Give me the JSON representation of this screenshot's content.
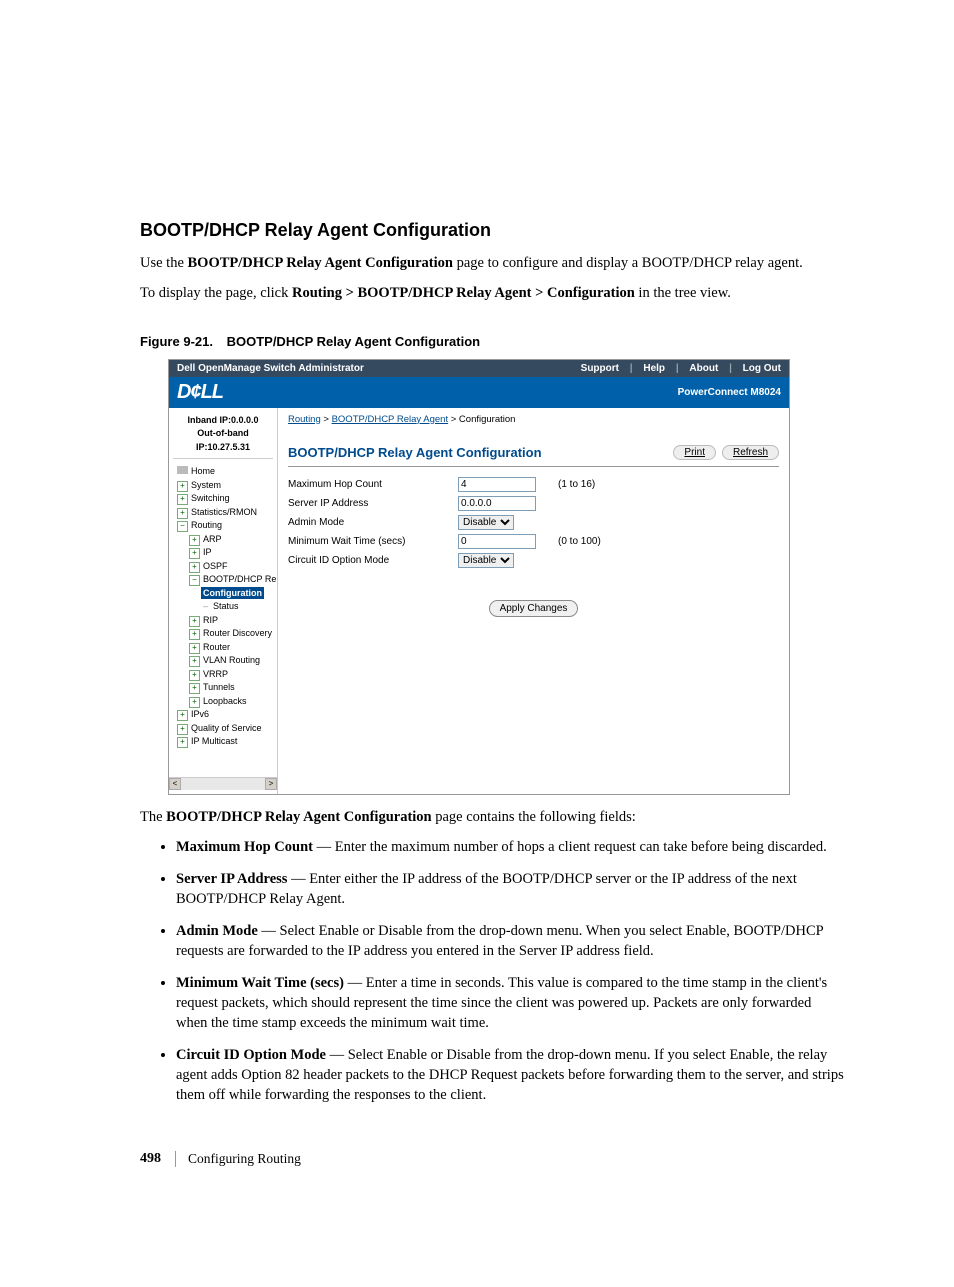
{
  "section_title": "BOOTP/DHCP Relay Agent Configuration",
  "intro1_pre": "Use the ",
  "intro1_bold": "BOOTP/DHCP Relay Agent Configuration",
  "intro1_post": " page to configure and display a BOOTP/DHCP relay agent.",
  "intro2_pre": "To display the page, click ",
  "intro2_bold": "Routing > BOOTP/DHCP Relay Agent > Configuration",
  "intro2_post": " in the tree view.",
  "figure": {
    "num": "Figure 9-21.",
    "title": "BOOTP/DHCP Relay Agent Configuration"
  },
  "shot": {
    "app_title": "Dell OpenManage Switch Administrator",
    "top_links": [
      "Support",
      "Help",
      "About",
      "Log Out"
    ],
    "logo": "D¢LL",
    "model": "PowerConnect M8024",
    "inband": "Inband IP:0.0.0.0",
    "outband": "Out-of-band IP:10.27.5.31",
    "tree": {
      "home": "Home",
      "l1": [
        "System",
        "Switching",
        "Statistics/RMON"
      ],
      "routing": "Routing",
      "routing_children_top": [
        "ARP",
        "IP",
        "OSPF"
      ],
      "bootp": "BOOTP/DHCP Relay Ag",
      "bootp_children": [
        {
          "label": "Configuration",
          "sel": true
        },
        {
          "label": "Status",
          "sel": false
        }
      ],
      "routing_children_bottom": [
        "RIP",
        "Router Discovery",
        "Router",
        "VLAN Routing",
        "VRRP",
        "Tunnels",
        "Loopbacks"
      ],
      "l1_bottom": [
        "IPv6",
        "Quality of Service",
        "IP Multicast"
      ]
    },
    "crumbs": {
      "a": "Routing",
      "b": "BOOTP/DHCP Relay Agent",
      "c": "Configuration"
    },
    "page_title": "BOOTP/DHCP Relay Agent Configuration",
    "print": "Print",
    "refresh": "Refresh",
    "rows": [
      {
        "label": "Maximum Hop Count",
        "type": "text",
        "value": "4",
        "hint": "(1 to 16)"
      },
      {
        "label": "Server IP Address",
        "type": "text",
        "value": "0.0.0.0",
        "hint": ""
      },
      {
        "label": "Admin Mode",
        "type": "select",
        "value": "Disable",
        "hint": ""
      },
      {
        "label": "Minimum Wait Time (secs)",
        "type": "text",
        "value": "0",
        "hint": "(0 to 100)"
      },
      {
        "label": "Circuit ID Option Mode",
        "type": "select",
        "value": "Disable",
        "hint": ""
      }
    ],
    "apply": "Apply Changes"
  },
  "fields_intro_pre": "The ",
  "fields_intro_bold": "BOOTP/DHCP Relay Agent Configuration",
  "fields_intro_post": " page contains the following fields:",
  "fields": [
    {
      "term": "Maximum Hop Count",
      "desc": " — Enter the maximum number of hops a client request can take before being discarded."
    },
    {
      "term": "Server IP Address",
      "desc": " — Enter either the IP address of the BOOTP/DHCP server or the IP address of the next BOOTP/DHCP Relay Agent."
    },
    {
      "term": "Admin Mode",
      "desc": " — Select Enable or Disable from the drop-down menu. When you select Enable, BOOTP/DHCP requests are forwarded to the IP address you entered in the Server IP address field."
    },
    {
      "term": "Minimum Wait Time (secs)",
      "desc": " — Enter a time in seconds. This value is compared to the time stamp in the client's request packets, which should represent the time since the client was powered up. Packets are only forwarded when the time stamp exceeds the minimum wait time."
    },
    {
      "term": "Circuit ID Option Mode",
      "desc": " — Select Enable or Disable from the drop-down menu. If you select Enable, the relay agent adds Option 82 header packets to the DHCP Request packets before forwarding them to the server, and strips them off while forwarding the responses to the client."
    }
  ],
  "footer": {
    "page_no": "498",
    "chapter": "Configuring Routing"
  }
}
